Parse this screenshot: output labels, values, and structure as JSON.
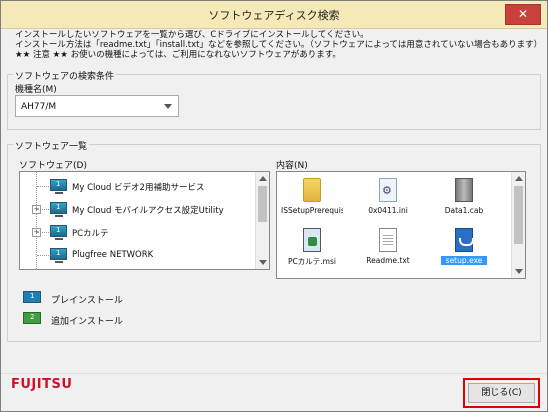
{
  "window": {
    "title": "ソフトウェアディスク検索",
    "close_glyph": "✕"
  },
  "intro": {
    "line1": "インストールしたいソフトウェアを一覧から選び、Cドライブにインストールしてください。",
    "line2": "インストール方法は「readme.txt」「install.txt」などを参照してください。（ソフトウェアによっては用意されていない場合もあります）",
    "line3": "★★ 注意 ★★ お使いの機種によっては、ご利用になれないソフトウェアがあります。"
  },
  "search": {
    "group_label": "ソフトウェアの検索条件",
    "model_label": "機種名(M)",
    "model_value": "AH77/M"
  },
  "list": {
    "group_label": "ソフトウェア一覧",
    "software_label": "ソフトウェア(D)",
    "content_label": "内容(N)",
    "items": [
      {
        "num": "1",
        "label": "My Cloud ビデオ2用補助サービス"
      },
      {
        "num": "1",
        "label": "My Cloud モバイルアクセス設定Utility"
      },
      {
        "num": "1",
        "label": "PCカルテ"
      },
      {
        "num": "1",
        "label": "Plugfree NETWORK"
      }
    ],
    "files": [
      {
        "name": "ISSetupPrerequis...",
        "icon": "folder-icon"
      },
      {
        "name": "0x0411.ini",
        "icon": "settings-file-icon"
      },
      {
        "name": "Data1.cab",
        "icon": "cabinet-file-icon"
      },
      {
        "name": "PCカルテ.msi",
        "icon": "installer-icon"
      },
      {
        "name": "Readme.txt",
        "icon": "text-file-icon"
      },
      {
        "name": "setup.exe",
        "icon": "setup-icon"
      }
    ]
  },
  "legend": {
    "preinstall": {
      "num": "1",
      "label": "プレインストール",
      "color": "#1e7fb0"
    },
    "addinstall": {
      "num": "2",
      "label": "追加インストール",
      "color": "#3f9e3f"
    }
  },
  "footer": {
    "logo": "FUJITSU",
    "close_button": "閉じる(C)"
  },
  "colors": {
    "titlebar": "#f6e9b8",
    "highlight": "#e00000",
    "brand": "#d0112b",
    "selection": "#3399ff"
  }
}
